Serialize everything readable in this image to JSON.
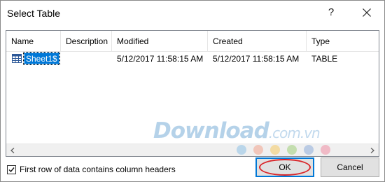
{
  "window": {
    "title": "Select Table",
    "help_label": "?"
  },
  "table": {
    "columns": [
      "Name",
      "Description",
      "Modified",
      "Created",
      "Type"
    ],
    "rows": [
      {
        "name": "Sheet1$",
        "description": "",
        "modified": "5/12/2017 11:58:15 AM",
        "created": "5/12/2017 11:58:15 AM",
        "type": "TABLE",
        "icon": "table-icon",
        "selected": true
      }
    ]
  },
  "options": {
    "first_row_headers_label": "First row of data contains column headers",
    "first_row_headers_checked": true
  },
  "buttons": {
    "ok_label": "OK",
    "cancel_label": "Cancel"
  },
  "watermark": {
    "brand": "Download",
    "tld": ".com.vn"
  },
  "colors": {
    "selection": "#0078d7",
    "highlight_ring": "#d9262a",
    "dots": [
      "#a8cde8",
      "#f2b8a8",
      "#f4d48a",
      "#b5d89a",
      "#a8bfe0",
      "#f0a8b8"
    ]
  }
}
